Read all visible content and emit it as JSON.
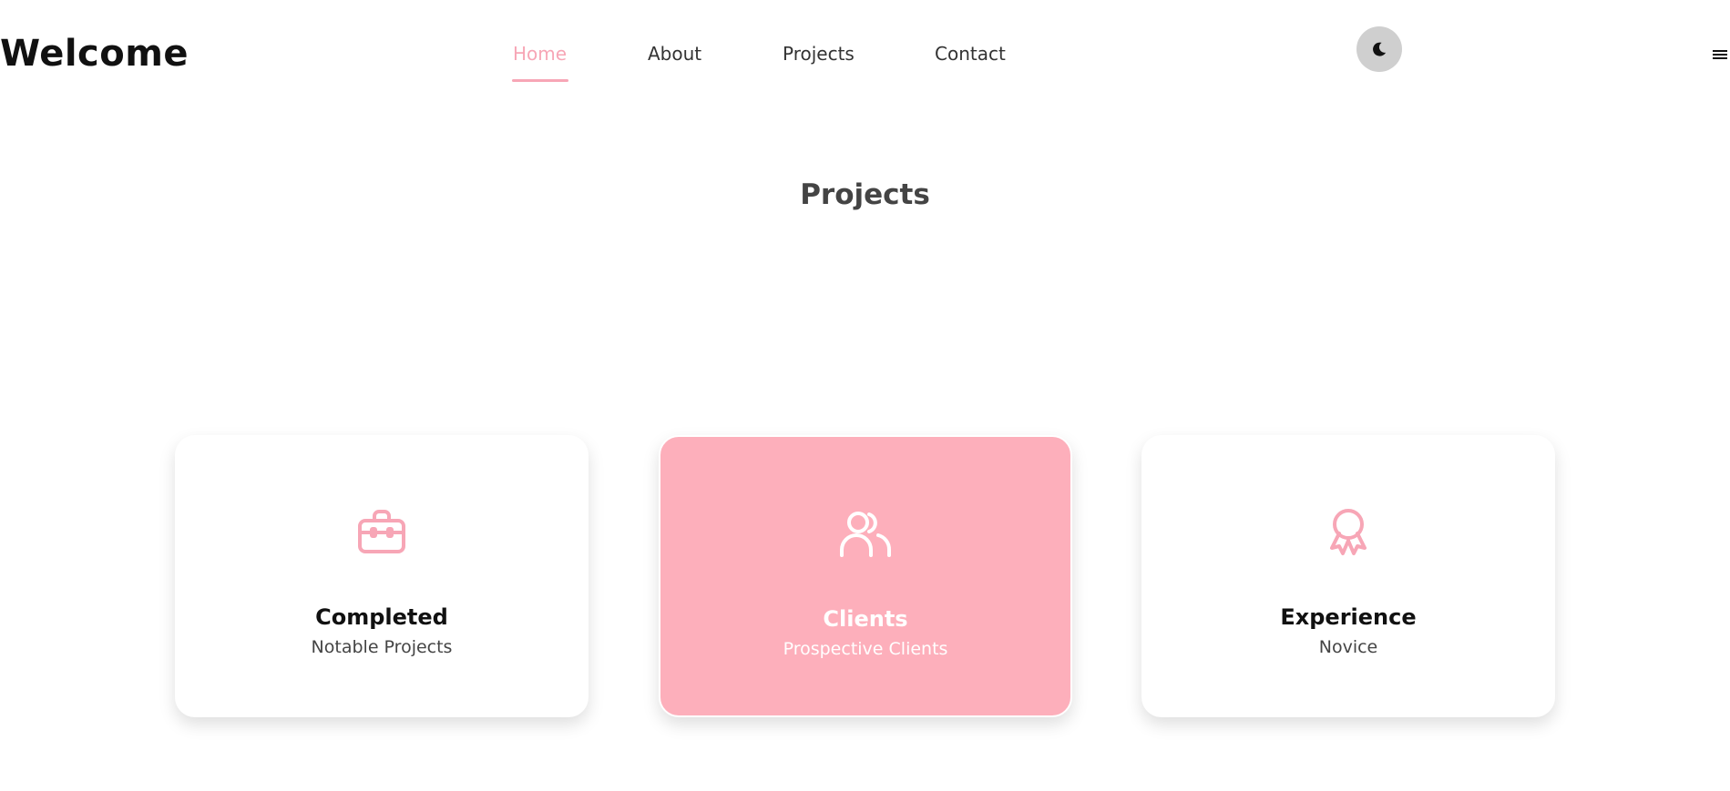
{
  "header": {
    "logo": "Welcome",
    "nav": [
      {
        "label": "Home",
        "active": true
      },
      {
        "label": "About",
        "active": false
      },
      {
        "label": "Projects",
        "active": false
      },
      {
        "label": "Contact",
        "active": false
      }
    ],
    "theme_toggle_icon": "moon-icon",
    "menu_icon": "hamburger-menu-icon"
  },
  "section": {
    "title": "Projects"
  },
  "cards": [
    {
      "icon": "briefcase-icon",
      "title": "Completed",
      "subtitle": "Notable Projects",
      "highlighted": false
    },
    {
      "icon": "users-icon",
      "title": "Clients",
      "subtitle": "Prospective Clients",
      "highlighted": true
    },
    {
      "icon": "award-icon",
      "title": "Experience",
      "subtitle": "Novice",
      "highlighted": false
    }
  ],
  "colors": {
    "accent": "#f7a6b6",
    "card_highlight": "#fdafbb",
    "toggle_bg": "#cfcfcf"
  }
}
